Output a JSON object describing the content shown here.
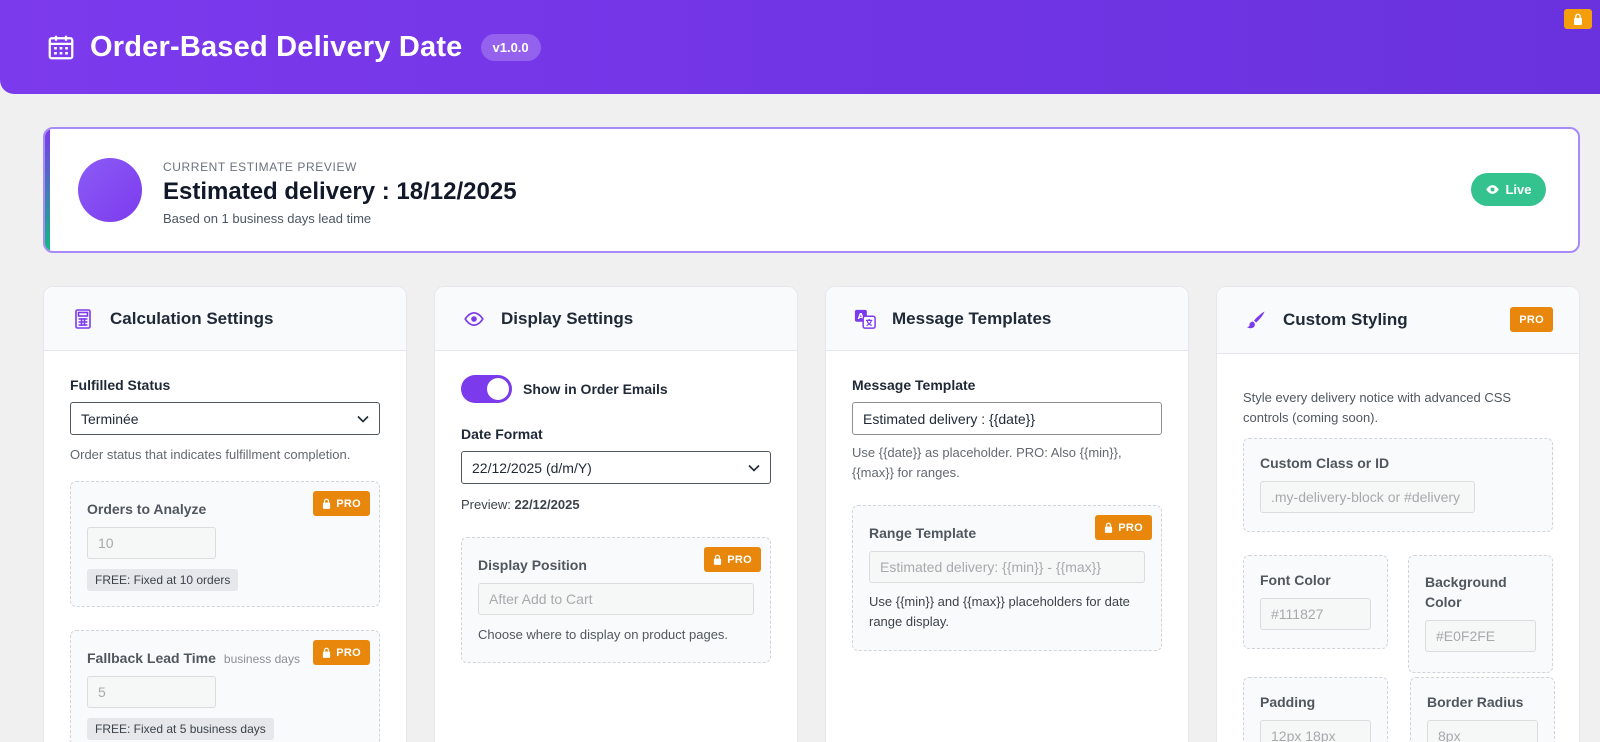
{
  "header": {
    "title": "Order-Based Delivery Date",
    "version": "v1.0.0"
  },
  "preview": {
    "eyebrow": "CURRENT ESTIMATE PREVIEW",
    "estimate": "Estimated delivery : 18/12/2025",
    "basis": "Based on 1 business days lead time",
    "live_label": "Live"
  },
  "calculation": {
    "title": "Calculation Settings",
    "fulfilled_label": "Fulfilled Status",
    "fulfilled_value": "Terminée",
    "fulfilled_help": "Order status that indicates fulfillment completion.",
    "orders_label": "Orders to Analyze",
    "orders_value": "10",
    "orders_note": "FREE: Fixed at 10 orders",
    "fallback_label": "Fallback Lead Time",
    "fallback_unit": "business days",
    "fallback_value": "5",
    "fallback_note": "FREE: Fixed at 5 business days"
  },
  "display": {
    "title": "Display Settings",
    "show_emails_label": "Show in Order Emails",
    "date_format_label": "Date Format",
    "date_format_value": "22/12/2025 (d/m/Y)",
    "preview_prefix": "Preview:",
    "preview_value": "22/12/2025",
    "position_label": "Display Position",
    "position_placeholder": "After Add to Cart",
    "position_help": "Choose where to display on product pages."
  },
  "templates": {
    "title": "Message Templates",
    "message_label": "Message Template",
    "message_value": "Estimated delivery : {{date}}",
    "message_help": "Use {{date}} as placeholder. PRO: Also {{min}}, {{max}} for ranges.",
    "range_label": "Range Template",
    "range_placeholder": "Estimated delivery: {{min}} - {{max}}",
    "range_help": "Use {{min}} and {{max}} placeholders for date range display."
  },
  "styling": {
    "title": "Custom Styling",
    "intro": "Style every delivery notice with advanced CSS controls (coming soon).",
    "class_label": "Custom Class or ID",
    "class_placeholder": ".my-delivery-block or #delivery",
    "font_color_label": "Font Color",
    "font_color_value": "#111827",
    "bg_color_label": "Background Color",
    "bg_color_value": "#E0F2FE",
    "padding_label": "Padding",
    "padding_value": "12px 18px",
    "radius_label": "Border Radius",
    "radius_value": "8px"
  },
  "pro_label": "PRO",
  "colors": {
    "brand": "#7c3aed",
    "pro": "#e8870c",
    "live": "#34c38f"
  }
}
